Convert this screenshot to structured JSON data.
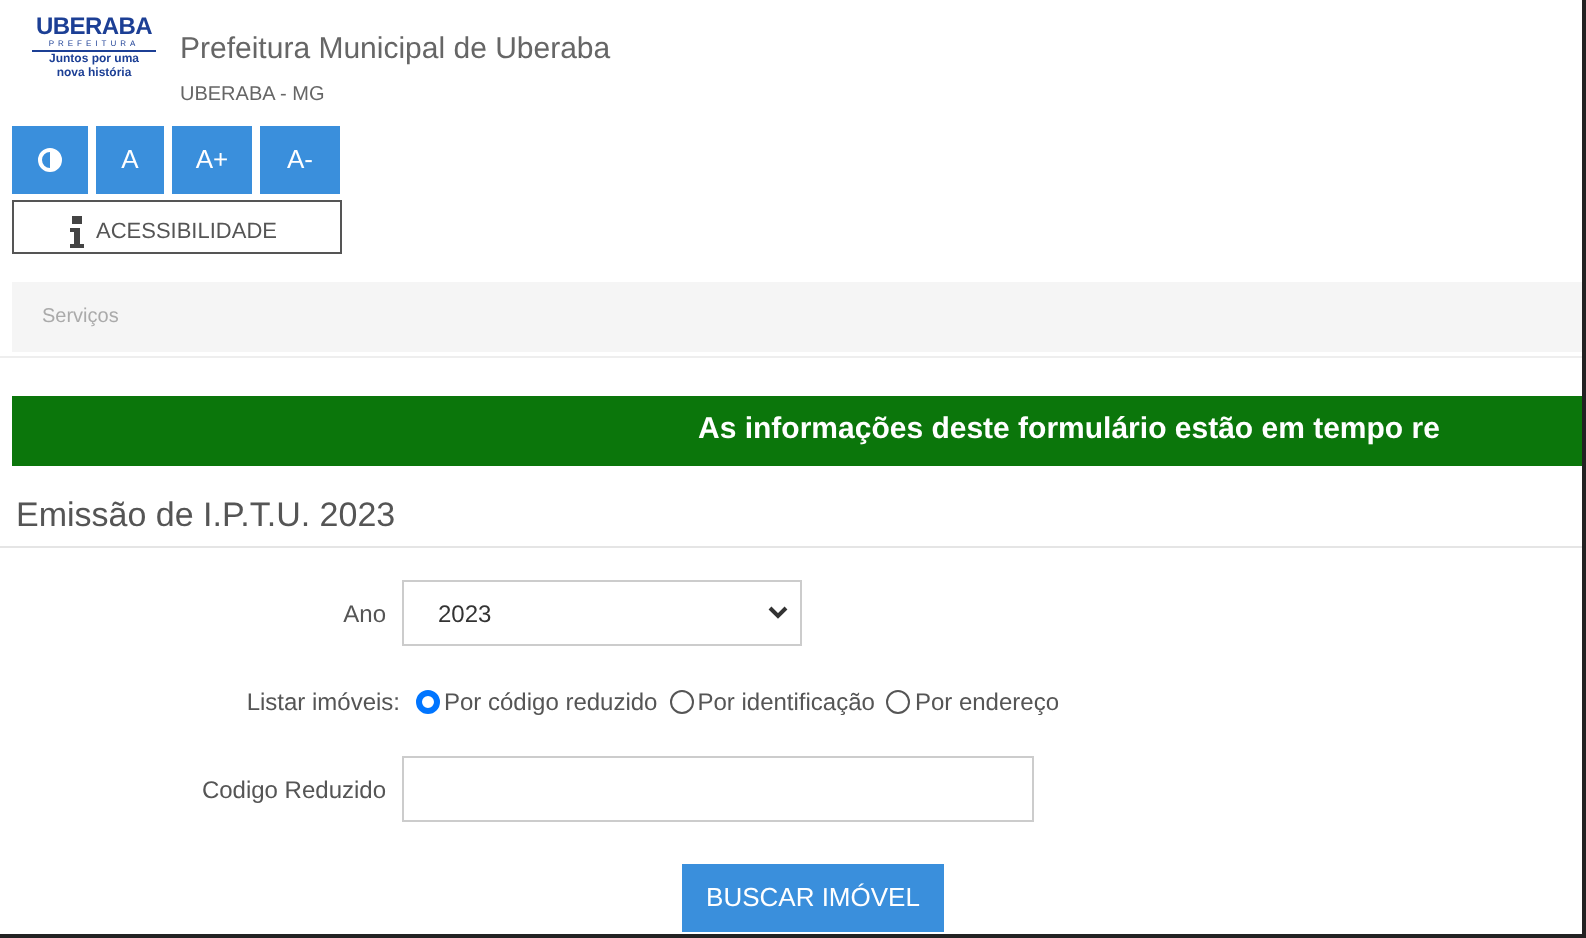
{
  "logo": {
    "name": "UBERABA",
    "subtitle": "PREFEITURA",
    "slogan": "Juntos por uma nova história"
  },
  "header": {
    "title": "Prefeitura Municipal de Uberaba",
    "location": "UBERABA - MG"
  },
  "accessibility_buttons": [
    {
      "kind": "contrast"
    },
    {
      "kind": "text",
      "label": "A"
    },
    {
      "kind": "text",
      "label": "A+"
    },
    {
      "kind": "text",
      "label": "A-"
    }
  ],
  "accessibility_link": {
    "label": "ACESSIBILIDADE"
  },
  "breadcrumb": "Serviços",
  "banner": "As informações deste formulário estão em tempo re",
  "form": {
    "title": "Emissão de I.P.T.U. 2023",
    "year": {
      "label": "Ano",
      "value": "2023"
    },
    "list_by": {
      "label": "Listar imóveis:",
      "options": [
        {
          "label": "Por código reduzido",
          "selected": true
        },
        {
          "label": "Por identificação",
          "selected": false
        },
        {
          "label": "Por endereço",
          "selected": false
        }
      ]
    },
    "code": {
      "label": "Codigo Reduzido"
    },
    "submit": "BUSCAR IMÓVEL"
  }
}
